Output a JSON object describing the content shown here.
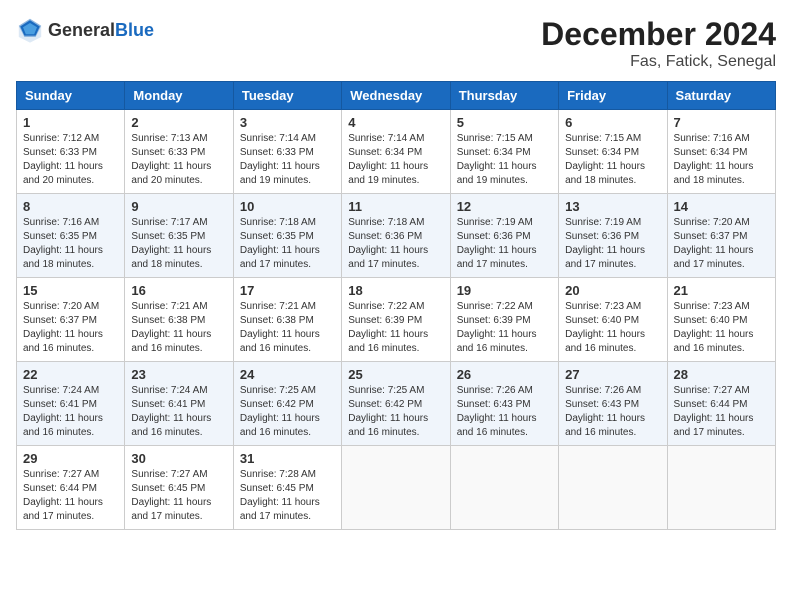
{
  "header": {
    "logo_general": "General",
    "logo_blue": "Blue",
    "title": "December 2024",
    "subtitle": "Fas, Fatick, Senegal"
  },
  "calendar": {
    "days_of_week": [
      "Sunday",
      "Monday",
      "Tuesday",
      "Wednesday",
      "Thursday",
      "Friday",
      "Saturday"
    ],
    "weeks": [
      [
        {
          "day": "1",
          "info": "Sunrise: 7:12 AM\nSunset: 6:33 PM\nDaylight: 11 hours\nand 20 minutes."
        },
        {
          "day": "2",
          "info": "Sunrise: 7:13 AM\nSunset: 6:33 PM\nDaylight: 11 hours\nand 20 minutes."
        },
        {
          "day": "3",
          "info": "Sunrise: 7:14 AM\nSunset: 6:33 PM\nDaylight: 11 hours\nand 19 minutes."
        },
        {
          "day": "4",
          "info": "Sunrise: 7:14 AM\nSunset: 6:34 PM\nDaylight: 11 hours\nand 19 minutes."
        },
        {
          "day": "5",
          "info": "Sunrise: 7:15 AM\nSunset: 6:34 PM\nDaylight: 11 hours\nand 19 minutes."
        },
        {
          "day": "6",
          "info": "Sunrise: 7:15 AM\nSunset: 6:34 PM\nDaylight: 11 hours\nand 18 minutes."
        },
        {
          "day": "7",
          "info": "Sunrise: 7:16 AM\nSunset: 6:34 PM\nDaylight: 11 hours\nand 18 minutes."
        }
      ],
      [
        {
          "day": "8",
          "info": "Sunrise: 7:16 AM\nSunset: 6:35 PM\nDaylight: 11 hours\nand 18 minutes."
        },
        {
          "day": "9",
          "info": "Sunrise: 7:17 AM\nSunset: 6:35 PM\nDaylight: 11 hours\nand 18 minutes."
        },
        {
          "day": "10",
          "info": "Sunrise: 7:18 AM\nSunset: 6:35 PM\nDaylight: 11 hours\nand 17 minutes."
        },
        {
          "day": "11",
          "info": "Sunrise: 7:18 AM\nSunset: 6:36 PM\nDaylight: 11 hours\nand 17 minutes."
        },
        {
          "day": "12",
          "info": "Sunrise: 7:19 AM\nSunset: 6:36 PM\nDaylight: 11 hours\nand 17 minutes."
        },
        {
          "day": "13",
          "info": "Sunrise: 7:19 AM\nSunset: 6:36 PM\nDaylight: 11 hours\nand 17 minutes."
        },
        {
          "day": "14",
          "info": "Sunrise: 7:20 AM\nSunset: 6:37 PM\nDaylight: 11 hours\nand 17 minutes."
        }
      ],
      [
        {
          "day": "15",
          "info": "Sunrise: 7:20 AM\nSunset: 6:37 PM\nDaylight: 11 hours\nand 16 minutes."
        },
        {
          "day": "16",
          "info": "Sunrise: 7:21 AM\nSunset: 6:38 PM\nDaylight: 11 hours\nand 16 minutes."
        },
        {
          "day": "17",
          "info": "Sunrise: 7:21 AM\nSunset: 6:38 PM\nDaylight: 11 hours\nand 16 minutes."
        },
        {
          "day": "18",
          "info": "Sunrise: 7:22 AM\nSunset: 6:39 PM\nDaylight: 11 hours\nand 16 minutes."
        },
        {
          "day": "19",
          "info": "Sunrise: 7:22 AM\nSunset: 6:39 PM\nDaylight: 11 hours\nand 16 minutes."
        },
        {
          "day": "20",
          "info": "Sunrise: 7:23 AM\nSunset: 6:40 PM\nDaylight: 11 hours\nand 16 minutes."
        },
        {
          "day": "21",
          "info": "Sunrise: 7:23 AM\nSunset: 6:40 PM\nDaylight: 11 hours\nand 16 minutes."
        }
      ],
      [
        {
          "day": "22",
          "info": "Sunrise: 7:24 AM\nSunset: 6:41 PM\nDaylight: 11 hours\nand 16 minutes."
        },
        {
          "day": "23",
          "info": "Sunrise: 7:24 AM\nSunset: 6:41 PM\nDaylight: 11 hours\nand 16 minutes."
        },
        {
          "day": "24",
          "info": "Sunrise: 7:25 AM\nSunset: 6:42 PM\nDaylight: 11 hours\nand 16 minutes."
        },
        {
          "day": "25",
          "info": "Sunrise: 7:25 AM\nSunset: 6:42 PM\nDaylight: 11 hours\nand 16 minutes."
        },
        {
          "day": "26",
          "info": "Sunrise: 7:26 AM\nSunset: 6:43 PM\nDaylight: 11 hours\nand 16 minutes."
        },
        {
          "day": "27",
          "info": "Sunrise: 7:26 AM\nSunset: 6:43 PM\nDaylight: 11 hours\nand 16 minutes."
        },
        {
          "day": "28",
          "info": "Sunrise: 7:27 AM\nSunset: 6:44 PM\nDaylight: 11 hours\nand 17 minutes."
        }
      ],
      [
        {
          "day": "29",
          "info": "Sunrise: 7:27 AM\nSunset: 6:44 PM\nDaylight: 11 hours\nand 17 minutes."
        },
        {
          "day": "30",
          "info": "Sunrise: 7:27 AM\nSunset: 6:45 PM\nDaylight: 11 hours\nand 17 minutes."
        },
        {
          "day": "31",
          "info": "Sunrise: 7:28 AM\nSunset: 6:45 PM\nDaylight: 11 hours\nand 17 minutes."
        },
        {
          "day": "",
          "info": ""
        },
        {
          "day": "",
          "info": ""
        },
        {
          "day": "",
          "info": ""
        },
        {
          "day": "",
          "info": ""
        }
      ]
    ]
  }
}
